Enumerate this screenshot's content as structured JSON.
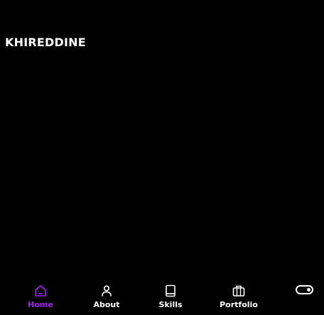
{
  "header": {
    "brand": "KHIREDDINE"
  },
  "bottom_nav": {
    "items": [
      {
        "label": "Home",
        "icon": "home-icon",
        "active": true
      },
      {
        "label": "About",
        "icon": "user-icon",
        "active": false
      },
      {
        "label": "Skills",
        "icon": "book-icon",
        "active": false
      },
      {
        "label": "Portfolio",
        "icon": "briefcase-icon",
        "active": false
      }
    ],
    "theme_toggle": {
      "icon": "toggle-icon",
      "state": "on"
    }
  },
  "colors": {
    "background": "#000000",
    "text": "#ffffff",
    "accent": "#a020f0"
  }
}
